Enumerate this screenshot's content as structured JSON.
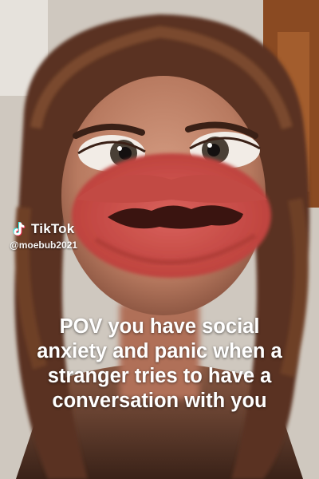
{
  "watermark": {
    "brand": "TikTok",
    "handle": "@moebub2021",
    "logo_icon": "tiktok-logo-icon"
  },
  "caption": {
    "lines": [
      "POV you have social",
      "anxiety and panic when a",
      "stranger tries to have a",
      "conversation with you"
    ]
  },
  "scene": {
    "description_icon": "face-with-large-mouth-filter-photo",
    "colors": {
      "hair": "#5a3220",
      "skin": "#c58d74",
      "lips": "#c8504c",
      "mouth_inner": "#3a1410",
      "background_wall": "#d9d4cc",
      "door_wood": "#8a4a22"
    }
  }
}
